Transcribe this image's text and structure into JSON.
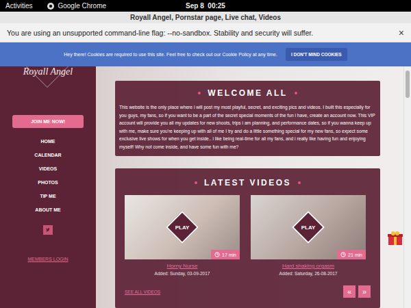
{
  "topbar": {
    "activities": "Activities",
    "app": "Google Chrome",
    "clock": "Sep 8  00:25"
  },
  "window": {
    "title": "Royall Angel, Pornstar page, Live chat, Videos"
  },
  "infobar": {
    "message": "You are using an unsupported command-line flag: --no-sandbox. Stability and security will suffer.",
    "close": "×"
  },
  "cookie": {
    "message": "Hey there! Cookies are required to use this site. Feel free to check out our Cookie Policy at any time.",
    "button": "I DON'T MIND COOKIES"
  },
  "sidebar": {
    "logo": "Royall Angel",
    "join": "JOIN ME NOW!",
    "items": [
      {
        "label": "HOME",
        "selected": false
      },
      {
        "label": "CALENDAR",
        "selected": false
      },
      {
        "label": "VIDEOS",
        "selected": false
      },
      {
        "label": "PHOTOS",
        "selected": false
      },
      {
        "label": "TIP ME",
        "selected": false
      },
      {
        "label": "ABOUT ME",
        "selected": false
      }
    ],
    "login": "MEMBERS LOGIN"
  },
  "welcome": {
    "title": "WELCOME ALL",
    "text": "This website is the only place where i will post my most playful, secret, and exciting pics and videos. I built this especially for you guys, my fans, so if you want to be a part of the secret special moments of the fun i have, create an account now. This VIP account will provide you all my updates for new shoots, trips i am planning, and performance dates, so if you wanna keep up with me, make sure you're keeping up with all of me I try and do a little something special for my new fans, so expect some exclusive live shows for when you get inside.. i like being real-time for all my fans, and i really like having fun and enjoying myself! Why not come inside, and have some fun with me?"
  },
  "videos": {
    "title": "LATEST VIDEOS",
    "items": [
      {
        "title": "Horny Nurse",
        "added": "Added: Sunday, 03-09-2017",
        "duration": "17 min",
        "play": "PLAY"
      },
      {
        "title": "Hard shaking orgasm",
        "added": "Added: Saturday, 26-08-2017",
        "duration": "21 min",
        "play": "PLAY"
      }
    ],
    "see_all": "SEE ALL VIDEOS",
    "pager": [
      "«",
      "»"
    ]
  }
}
